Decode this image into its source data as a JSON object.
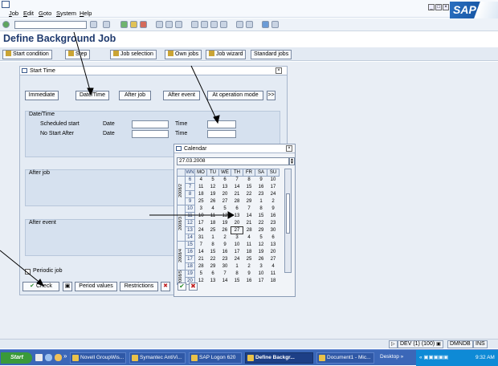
{
  "menu": [
    "Job",
    "Edit",
    "Goto",
    "System",
    "Help"
  ],
  "window": {
    "brand": "SAP"
  },
  "page_title": "Define Background Job",
  "app_toolbar": [
    "Start condition",
    "Step",
    "Job selection",
    "Own jobs",
    "Job wizard",
    "Standard jobs"
  ],
  "dialog": {
    "title": "Start Time",
    "buttons": [
      "Immediate",
      "Date/Time",
      "After job",
      "After event",
      "At operation mode",
      ">>"
    ],
    "datetime_group": "Date/Time",
    "scheduled_start": "Scheduled start",
    "no_start_after": "No Start After",
    "date_label": "Date",
    "time_label": "Time",
    "after_job_group": "After job",
    "after_event_group": "After event",
    "periodic_job": "Periodic job",
    "bottom_buttons": [
      "Check",
      "Period values",
      "Restrictions"
    ]
  },
  "calendar": {
    "title": "Calendar",
    "date_value": "27.03.2008",
    "headers": [
      "WN",
      "MO",
      "TU",
      "WE",
      "TH",
      "FR",
      "SA",
      "SU"
    ],
    "months": [
      {
        "label": "2008/2",
        "rows": 4
      },
      {
        "label": "2008/3",
        "rows": 5
      },
      {
        "label": "2008/4",
        "rows": 4
      },
      {
        "label": "2008/5",
        "rows": 2
      }
    ],
    "rows": [
      [
        "6",
        "4",
        "5",
        "6",
        "7",
        "8",
        "9",
        "10"
      ],
      [
        "7",
        "11",
        "12",
        "13",
        "14",
        "15",
        "16",
        "17"
      ],
      [
        "8",
        "18",
        "19",
        "20",
        "21",
        "22",
        "23",
        "24"
      ],
      [
        "9",
        "25",
        "26",
        "27",
        "28",
        "29",
        "1",
        "2"
      ],
      [
        "10",
        "3",
        "4",
        "5",
        "6",
        "7",
        "8",
        "9"
      ],
      [
        "11",
        "10",
        "11",
        "12",
        "13",
        "14",
        "15",
        "16"
      ],
      [
        "12",
        "17",
        "18",
        "19",
        "20",
        "21",
        "22",
        "23"
      ],
      [
        "13",
        "24",
        "25",
        "26",
        "27",
        "28",
        "29",
        "30"
      ],
      [
        "14",
        "31",
        "1",
        "2",
        "3",
        "4",
        "5",
        "6"
      ],
      [
        "15",
        "7",
        "8",
        "9",
        "10",
        "11",
        "12",
        "13"
      ],
      [
        "16",
        "14",
        "15",
        "16",
        "17",
        "18",
        "19",
        "20"
      ],
      [
        "17",
        "21",
        "22",
        "23",
        "24",
        "25",
        "26",
        "27"
      ],
      [
        "18",
        "28",
        "29",
        "30",
        "1",
        "2",
        "3",
        "4"
      ],
      [
        "19",
        "5",
        "6",
        "7",
        "8",
        "9",
        "10",
        "11"
      ],
      [
        "20",
        "12",
        "13",
        "14",
        "15",
        "16",
        "17",
        "18"
      ]
    ],
    "selected": "27"
  },
  "status": {
    "system": "DEV (1) (100)",
    "host": "DMNDB",
    "mode": "INS"
  },
  "taskbar": {
    "start": "Start",
    "tasks": [
      "Novell GroupWis...",
      "Symantec AntiVi...",
      "SAP Logon 620",
      "Define Backgr...",
      "Document1 - Mic...",
      "Desktop"
    ],
    "active_index": 3,
    "clock": "9:32 AM"
  }
}
